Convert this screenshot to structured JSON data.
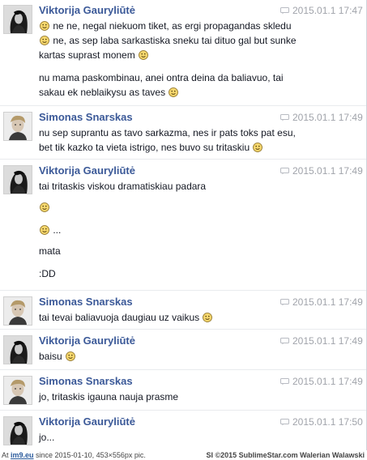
{
  "messages": [
    {
      "sender": "Viktorija Gauryliūtė",
      "avatar": "viktorija",
      "time": "2015.01.1 17:47",
      "lines": [
        {
          "emoji_lead": true,
          "text": " ne ne, negal niekuom tiket, as ergi propagandas skledu",
          "emoji_tail": false
        },
        {
          "emoji_lead": true,
          "text": " ne, as sep laba sarkastiska sneku tai dituo gal but sunke",
          "emoji_tail": false
        },
        {
          "emoji_lead": false,
          "text": "kartas suprast monem ",
          "emoji_tail": true
        },
        {
          "emoji_lead": false,
          "text": "nu mama paskombinau, anei ontra deina da baliavuo, tai",
          "emoji_tail": false
        },
        {
          "emoji_lead": false,
          "text": "sakau ek neblaikysu as taves ",
          "emoji_tail": true
        }
      ]
    },
    {
      "sender": "Simonas Snarskas",
      "avatar": "simonas",
      "time": "2015.01.1 17:49",
      "lines": [
        {
          "emoji_lead": false,
          "text": "nu sep suprantu as tavo sarkazma, nes ir pats toks pat esu,",
          "emoji_tail": false
        },
        {
          "emoji_lead": false,
          "text": "bet tik kazko ta vieta istrigo, nes buvo su tritaskiu ",
          "emoji_tail": true
        }
      ]
    },
    {
      "sender": "Viktorija Gauryliūtė",
      "avatar": "viktorija",
      "time": "2015.01.1 17:49",
      "lines": [
        {
          "emoji_lead": false,
          "text": "tai tritaskis viskou dramatiskiau padara",
          "emoji_tail": false
        },
        {
          "emoji_lead": true,
          "text": "",
          "emoji_tail": false
        },
        {
          "emoji_lead": true,
          "text": " ...",
          "emoji_tail": false
        },
        {
          "emoji_lead": false,
          "text": "mata",
          "emoji_tail": false
        },
        {
          "emoji_lead": false,
          "text": ":DD",
          "emoji_tail": false
        }
      ]
    },
    {
      "sender": "Simonas Snarskas",
      "avatar": "simonas",
      "time": "2015.01.1 17:49",
      "lines": [
        {
          "emoji_lead": false,
          "text": "tai tevai baliavuoja daugiau uz vaikus ",
          "emoji_tail": true
        }
      ]
    },
    {
      "sender": "Viktorija Gauryliūtė",
      "avatar": "viktorija",
      "time": "2015.01.1 17:49",
      "lines": [
        {
          "emoji_lead": false,
          "text": "baisu ",
          "emoji_tail": true
        }
      ]
    },
    {
      "sender": "Simonas Snarskas",
      "avatar": "simonas",
      "time": "2015.01.1 17:49",
      "lines": [
        {
          "emoji_lead": false,
          "text": "jo, tritaskis igauna nauja prasme",
          "emoji_tail": false
        }
      ]
    },
    {
      "sender": "Viktorija Gauryliūtė",
      "avatar": "viktorija",
      "time": "2015.01.1 17:50",
      "lines": [
        {
          "emoji_lead": false,
          "text": "jo...",
          "emoji_tail": false
        }
      ]
    }
  ],
  "footer": {
    "prefix": "At ",
    "site": "im9.eu",
    "left_rest": " since 2015-01-10, 453×556px pic.",
    "right": "SI ©2015 SublimeStar.com Walerian Walawski"
  },
  "colors": {
    "sender": "#3b5998",
    "timestamp": "#a0a3aa",
    "text": "#141823",
    "emoji_face": "#f5d76e"
  },
  "icons": {
    "emoji": "smiley-icon",
    "timestamp": "chat-bubble-icon"
  }
}
